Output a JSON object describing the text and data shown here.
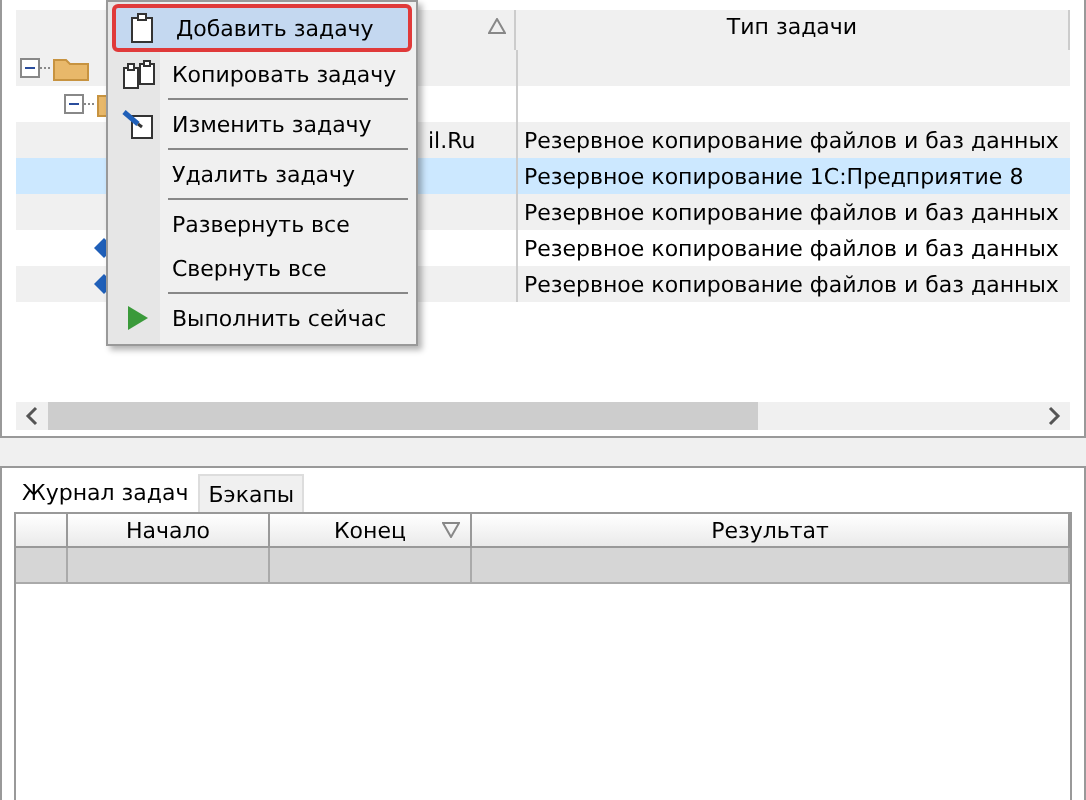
{
  "task_table": {
    "columns": [
      {
        "kind": "sorted_up"
      },
      {
        "kind": "plain",
        "label": "Тип задачи"
      }
    ],
    "rows": [
      {
        "kind": "root",
        "selected": false
      },
      {
        "kind": "folder",
        "selected": false
      },
      {
        "kind": "task",
        "name": "il.Ru",
        "type": "Резервное копирование файлов и баз данных",
        "selected": false
      },
      {
        "kind": "task",
        "type": "Резервное копирование 1С:Предприятие 8",
        "selected": true
      },
      {
        "kind": "task",
        "type": "Резервное копирование файлов и баз данных",
        "selected": false
      },
      {
        "kind": "task_visible",
        "type": "Резервное копирование файлов и баз данных",
        "selected": false
      },
      {
        "kind": "task_visible",
        "type": "Резервное копирование файлов и баз данных",
        "selected": false
      }
    ]
  },
  "context_menu": [
    {
      "kind": "paste",
      "label": "Добавить задачу",
      "selected": true
    },
    {
      "kind": "copy",
      "label": "Копировать задачу",
      "selected": false
    },
    {
      "kind": "separator"
    },
    {
      "kind": "edit",
      "label": "Изменить задачу",
      "selected": false
    },
    {
      "kind": "separator"
    },
    {
      "kind": "plain",
      "label": "Удалить задачу",
      "selected": false
    },
    {
      "kind": "separator"
    },
    {
      "kind": "plain",
      "label": "Развернуть все",
      "selected": false
    },
    {
      "kind": "plain",
      "label": "Свернуть все",
      "selected": false
    },
    {
      "kind": "separator"
    },
    {
      "kind": "play",
      "label": "Выполнить сейчас",
      "selected": false
    }
  ],
  "tabs": [
    {
      "label": "Журнал задач",
      "selected": true
    },
    {
      "label": "Бэкапы",
      "selected": false
    }
  ],
  "log_table": {
    "columns": [
      {
        "kind": "plain"
      },
      {
        "kind": "plain",
        "label": "Начало"
      },
      {
        "kind": "sorted_down",
        "label": "Конец"
      },
      {
        "kind": "plain",
        "label": "Результат"
      }
    ],
    "rows": [
      {
        "selected": true
      }
    ]
  }
}
